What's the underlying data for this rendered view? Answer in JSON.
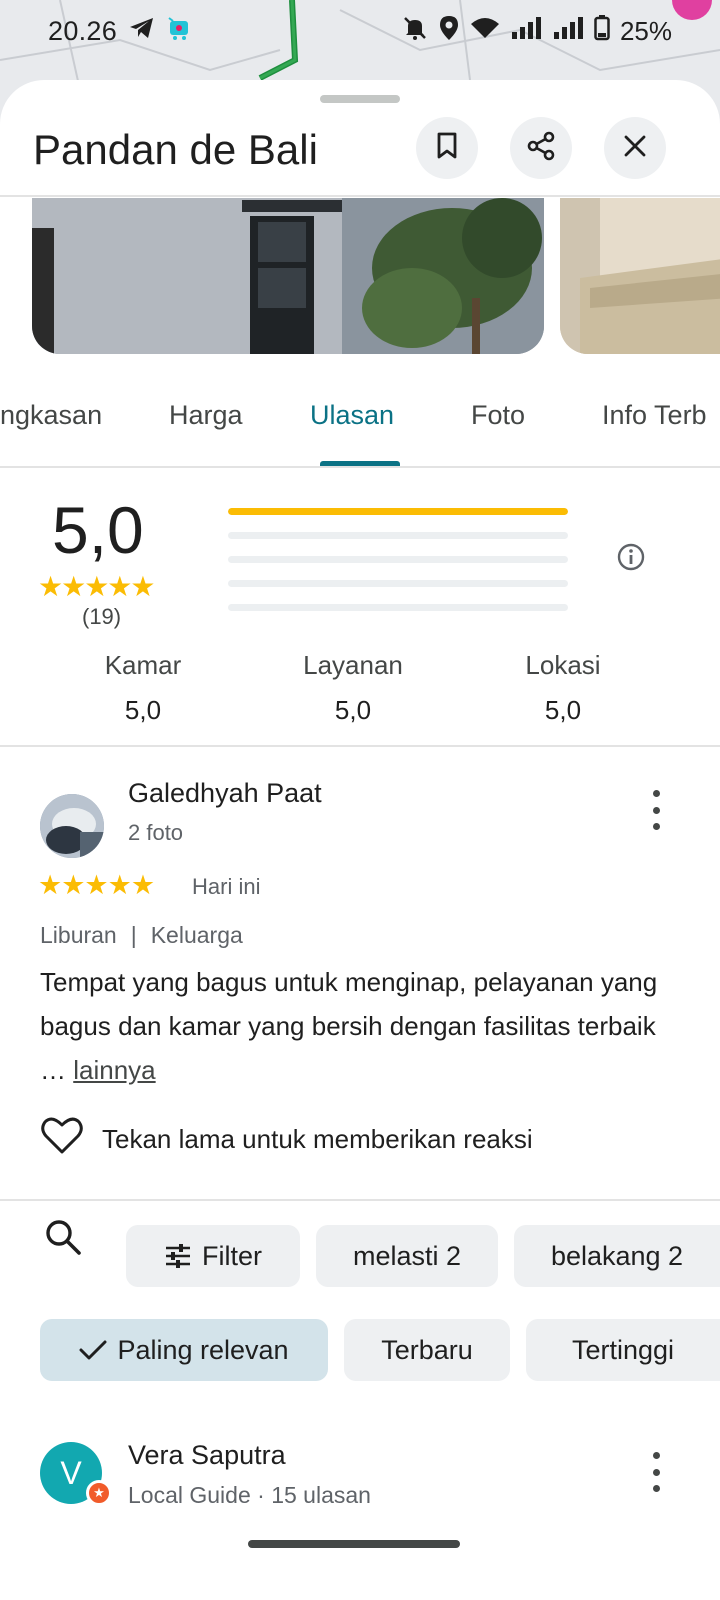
{
  "status_bar": {
    "time": "20.26",
    "battery": "25%"
  },
  "place": {
    "title": "Pandan de Bali"
  },
  "header_actions": {
    "save_icon": "bookmark-icon",
    "share_icon": "share-icon",
    "close_icon": "close-icon"
  },
  "tabs": [
    {
      "label": "ngkasan"
    },
    {
      "label": "Harga"
    },
    {
      "label": "Ulasan",
      "active": true
    },
    {
      "label": "Foto"
    },
    {
      "label": "Info Terb"
    }
  ],
  "rating": {
    "score": "5,0",
    "stars": "★★★★★",
    "count": "(19)",
    "distribution": [
      1.0,
      0,
      0,
      0,
      0
    ]
  },
  "aspects": [
    {
      "label": "Kamar",
      "value": "5,0"
    },
    {
      "label": "Layanan",
      "value": "5,0"
    },
    {
      "label": "Lokasi",
      "value": "5,0"
    }
  ],
  "review1": {
    "name": "Galedhyah Paat",
    "subtitle": "2 foto",
    "stars": "★★★★★",
    "date": "Hari ini",
    "tag1": "Liburan",
    "separator": "|",
    "tag2": "Keluarga",
    "text": "Tempat yang bagus untuk menginap, pelayanan yang bagus dan kamar yang bersih dengan fasilitas terbaik …",
    "more": "lainnya",
    "reaction_hint": "Tekan lama untuk memberikan reaksi"
  },
  "filters": {
    "filter_label": "Filter",
    "chips": [
      "melasti 2",
      "belakang 2"
    ]
  },
  "sort": {
    "options": [
      "Paling relevan",
      "Terbaru",
      "Tertinggi"
    ],
    "selected": "Paling relevan"
  },
  "review2": {
    "initial": "V",
    "name": "Vera Saputra",
    "subtitle": "Local Guide · 15 ulasan"
  },
  "colors": {
    "accent": "#0b7285",
    "star": "#fbbc04",
    "avatar_v": "#12a8b0",
    "badge": "#f15b2a"
  }
}
